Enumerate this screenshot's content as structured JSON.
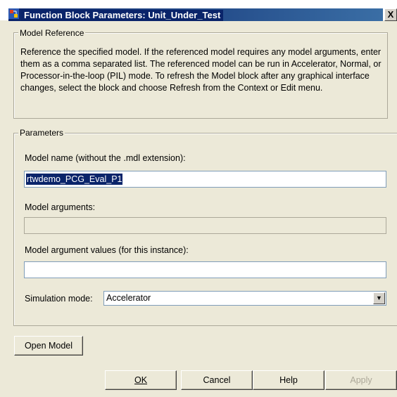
{
  "window": {
    "title": "Function Block Parameters: Unit_Under_Test",
    "close_label": "X"
  },
  "model_reference": {
    "legend": "Model Reference",
    "description": "Reference the specified model.  If the referenced model requires any model arguments, enter them as a comma separated list.  The referenced model can be run in Accelerator, Normal, or Processor-in-the-loop (PIL) mode.  To refresh the Model block after any graphical interface changes, select the block and choose Refresh from the Context or Edit menu."
  },
  "parameters": {
    "legend": "Parameters",
    "model_name_label": "Model name (without the .mdl extension):",
    "model_name_value": "rtwdemo_PCG_Eval_P1",
    "model_args_label": "Model arguments:",
    "model_args_value": "",
    "model_arg_values_label": "Model argument values (for this instance):",
    "model_arg_values_value": "",
    "sim_mode_label": "Simulation mode:",
    "sim_mode_value": "Accelerator"
  },
  "buttons": {
    "open_model": "Open Model",
    "ok": "OK",
    "cancel": "Cancel",
    "help": "Help",
    "apply": "Apply"
  },
  "icons": {
    "app": "simulink-block-icon",
    "dropdown": "chevron-down-icon"
  }
}
